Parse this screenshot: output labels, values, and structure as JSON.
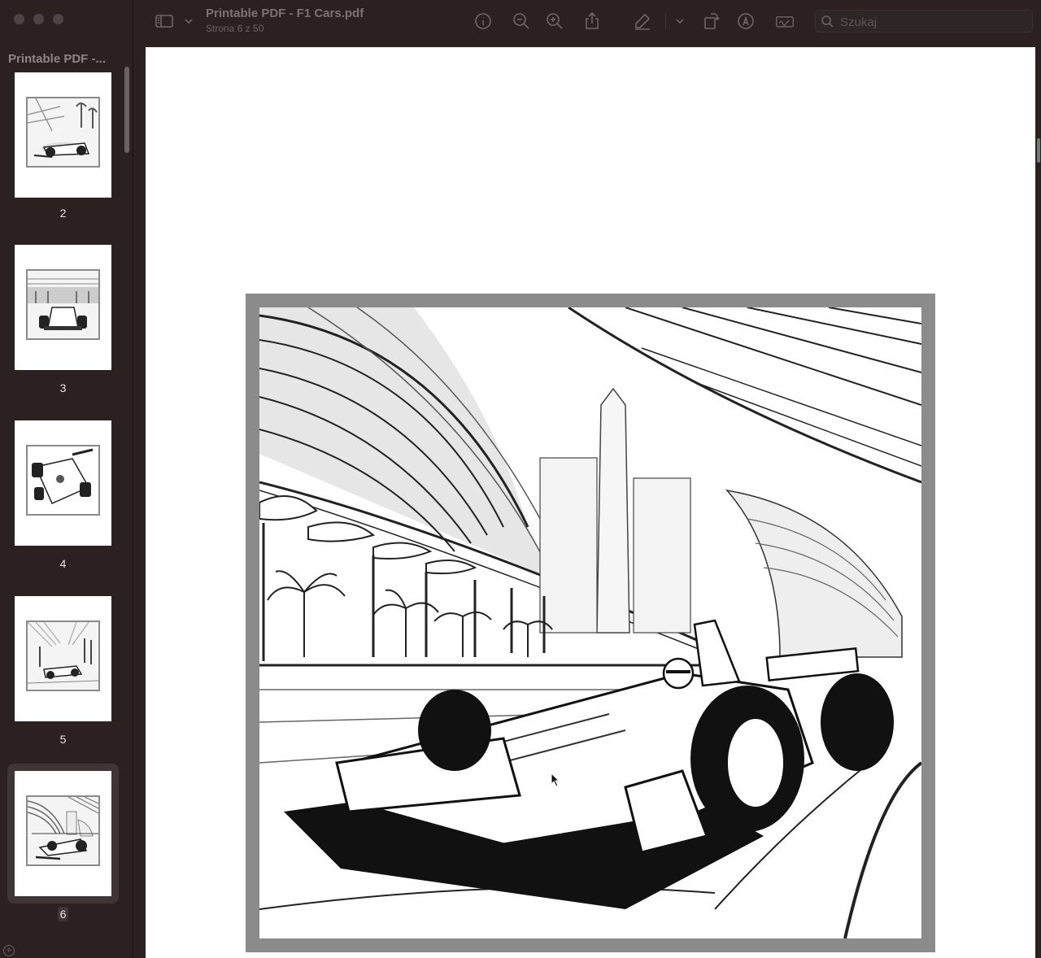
{
  "window": {
    "doc_title": "Printable PDF - F1 Cars.pdf",
    "doc_subtitle": "Strona 6 z 50"
  },
  "sidebar": {
    "title": "Printable PDF -...",
    "thumbnails": [
      {
        "label": "2",
        "selected": false
      },
      {
        "label": "3",
        "selected": false
      },
      {
        "label": "4",
        "selected": false
      },
      {
        "label": "5",
        "selected": false
      },
      {
        "label": "6",
        "selected": true
      }
    ]
  },
  "toolbar": {
    "icons": [
      "sidebar-toggle-icon",
      "chevron-down-icon",
      "info-icon",
      "zoom-out-icon",
      "zoom-in-icon",
      "share-icon",
      "highlight-pen-icon",
      "chevron-down-icon",
      "rotate-icon",
      "markup-icon",
      "signature-icon"
    ],
    "search_placeholder": "Szukaj"
  },
  "colors": {
    "chrome_bg": "#2b2121",
    "page_bg": "#ffffff",
    "frame": "#8b8b8b"
  }
}
